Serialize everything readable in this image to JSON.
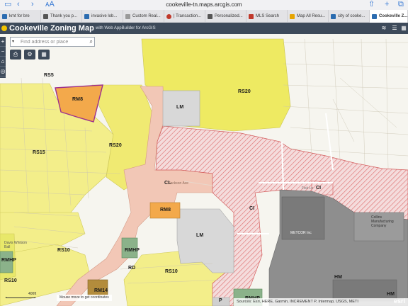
{
  "browser": {
    "url": "cookeville-tn.maps.arcgis.com",
    "tabs": [
      {
        "label": "kmt for bre",
        "icon": "bookmark-icon",
        "color": "#2b6cb0"
      },
      {
        "label": "Thank you p...",
        "icon": "page-icon",
        "color": "#555555"
      },
      {
        "label": "invasive lob...",
        "icon": "bookmark-icon",
        "color": "#2b6cb0"
      },
      {
        "label": "Custom Real...",
        "icon": "page-icon",
        "color": "#9a9a9a"
      },
      {
        "label": "| Transaction...",
        "icon": "record-icon",
        "color": "#c0392b"
      },
      {
        "label": "Personalized...",
        "icon": "page-icon",
        "color": "#555555"
      },
      {
        "label": "MLS Search",
        "icon": "mls-icon",
        "color": "#c0392b"
      },
      {
        "label": "Map All Resu...",
        "icon": "map-icon",
        "color": "#e6a400"
      },
      {
        "label": "city of cooke...",
        "icon": "bookmark-icon",
        "color": "#2b6cb0"
      },
      {
        "label": "Cookeville Z...",
        "icon": "bookmark-icon",
        "color": "#2b6cb0"
      }
    ]
  },
  "app": {
    "title": "Cookeville Zoning Map",
    "subtitle": "with Web AppBuilder for ArcGIS"
  },
  "search": {
    "placeholder": "Find address or place"
  },
  "map": {
    "zones": [
      {
        "label": "RS5"
      },
      {
        "label": "RM8"
      },
      {
        "label": "RS15"
      },
      {
        "label": "RS20"
      },
      {
        "label": "RS20"
      },
      {
        "label": "LM"
      },
      {
        "label": "CL"
      },
      {
        "label": "CI"
      },
      {
        "label": "CI"
      },
      {
        "label": "RM8"
      },
      {
        "label": "LM"
      },
      {
        "label": "RMHP"
      },
      {
        "label": "RD"
      },
      {
        "label": "RS10"
      },
      {
        "label": "RS10"
      },
      {
        "label": "RS10"
      },
      {
        "label": "RM14"
      },
      {
        "label": "HM"
      },
      {
        "label": "HM"
      },
      {
        "label": "RMHP"
      },
      {
        "label": "P"
      },
      {
        "label": "RMHP"
      }
    ],
    "place_labels": [
      "METCOR Inc",
      "Collins Manufacturing Company",
      "Davis Whitson Ball"
    ],
    "street_labels": [
      "Jackson Ave",
      "Fisk Ln"
    ],
    "coords_text": "Mouse move to get coordinates",
    "scale_text": "400ft",
    "attribution": "Sources: Esri, HERE, Garmin, INCREMENT P, Intermap, USGS, METI",
    "esri_logo": "esri",
    "colors": {
      "residential_yellow": "#f3ee8a",
      "light_yellow": "#e8e86a",
      "commercial_pink": "#f2c7b6",
      "industrial_hatch": "#e06b6b",
      "heavy_gray": "#8c8c8c",
      "light_gray": "#d6d6d6",
      "rm_orange": "#f3a94b",
      "rmhp_green": "#7aa87a",
      "header": "#3d4a5a"
    }
  }
}
